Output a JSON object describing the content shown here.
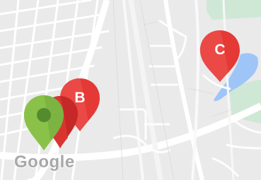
{
  "map": {
    "colors": {
      "land": "#eaeaea",
      "road": "#ffffff",
      "park": "#cfe8d5",
      "water": "#9fc5f8",
      "marker_red": "#e53935",
      "marker_dark_red": "#c62828",
      "marker_green": "#7cb342",
      "marker_green_dark": "#558b2f"
    },
    "markers": [
      {
        "label": "C",
        "icon": "map-pin-icon"
      },
      {
        "label": "B",
        "icon": "map-pin-icon"
      },
      {
        "label": "",
        "icon": "current-location-pin-icon"
      }
    ],
    "attribution": "Google"
  }
}
